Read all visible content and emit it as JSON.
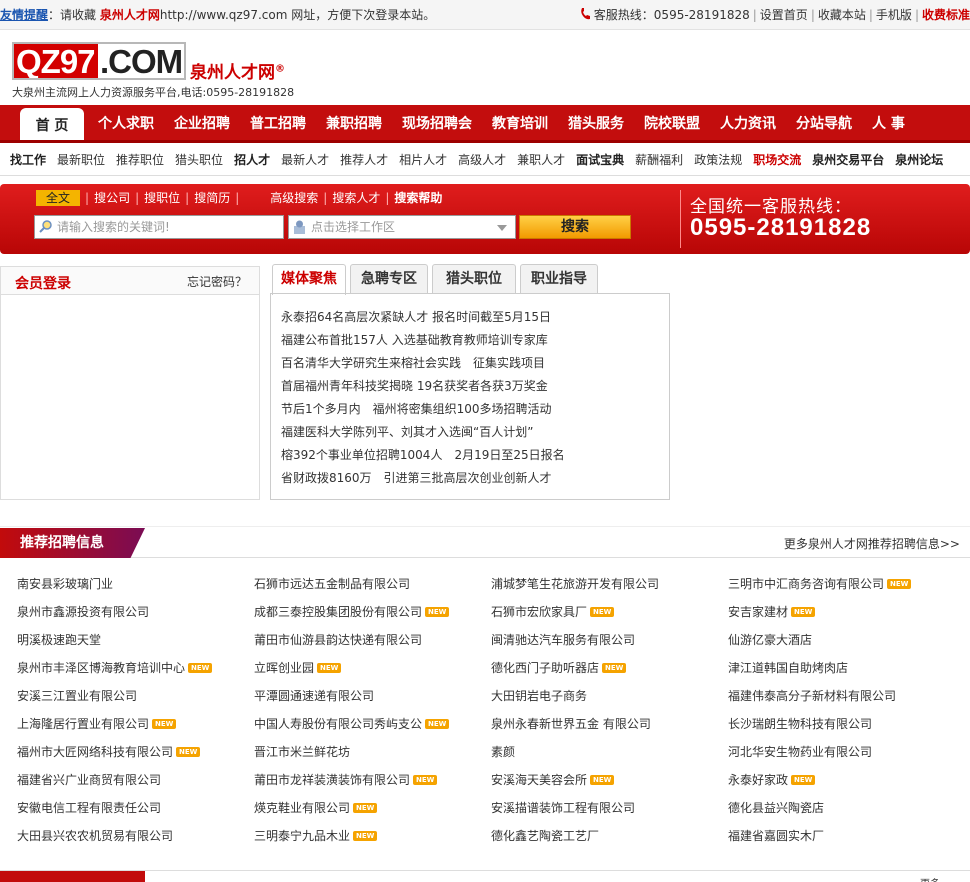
{
  "topbar": {
    "tip_label": "友情提醒",
    "tip_text": "：请收藏 ",
    "site_name": "泉州人才网",
    "tip_url": "http://www.qz97.com 网址，方便下次登录本站。",
    "hotline": "客服热线：0595-28191828",
    "links": [
      "设置首页",
      "收藏本站",
      "手机版"
    ],
    "fee_link": "收费标准"
  },
  "header": {
    "logo_qz": "QZ97",
    "logo_com": ".COM",
    "logo_cn": "泉州人才网",
    "logo_reg": "®",
    "slogan": "大泉州主流网上人力资源服务平台,电话:0595-28191828"
  },
  "nav": {
    "home": "首 页",
    "items": [
      "个人求职",
      "企业招聘",
      "普工招聘",
      "兼职招聘",
      "现场招聘会",
      "教育培训",
      "猎头服务",
      "院校联盟",
      "人力资讯",
      "分站导航",
      "人 事"
    ]
  },
  "subnav": [
    {
      "label": "找工作",
      "style": "b"
    },
    {
      "label": "最新职位",
      "style": ""
    },
    {
      "label": "推荐职位",
      "style": ""
    },
    {
      "label": "猎头职位",
      "style": ""
    },
    {
      "label": "招人才",
      "style": "b"
    },
    {
      "label": "最新人才",
      "style": ""
    },
    {
      "label": "推荐人才",
      "style": ""
    },
    {
      "label": "相片人才",
      "style": ""
    },
    {
      "label": "高级人才",
      "style": ""
    },
    {
      "label": "兼职人才",
      "style": ""
    },
    {
      "label": "面试宝典",
      "style": "b"
    },
    {
      "label": "薪酬福利",
      "style": ""
    },
    {
      "label": "政策法规",
      "style": ""
    },
    {
      "label": "职场交流",
      "style": "rb"
    },
    {
      "label": "泉州交易平台",
      "style": "b"
    },
    {
      "label": "泉州论坛",
      "style": "b"
    }
  ],
  "search": {
    "tab_all": "全文",
    "tabs": [
      "搜公司",
      "搜职位",
      "搜简历"
    ],
    "adv": [
      "高级搜索",
      "搜索人才"
    ],
    "help": "搜索帮助",
    "keyword_placeholder": "请输入搜索的关键词!",
    "area_placeholder": "点击选择工作区",
    "button": "搜索",
    "hotline_title": "全国统一客服热线：",
    "hotline_number": "0595-28191828"
  },
  "login": {
    "title": "会员登录",
    "forgot": "忘记密码？"
  },
  "news": {
    "tabs": [
      "媒体聚焦",
      "急聘专区",
      "猎头职位",
      "职业指导"
    ],
    "items": [
      "永泰招64名高层次紧缺人才 报名时间截至5月15日",
      "福建公布首批157人 入选基础教育教师培训专家库",
      "百名清华大学研究生来榕社会实践　征集实践项目",
      "首届福州青年科技奖揭晓 19名获奖者各获3万奖金",
      "节后1个多月内　福州将密集组织100多场招聘活动",
      "福建医科大学陈列平、刘其才入选闽“百人计划”",
      "榕392个事业单位招聘1004人　2月19日至25日报名",
      "省财政拨8160万　引进第三批高层次创业创新人才"
    ]
  },
  "recommend": {
    "title": "推荐招聘信息",
    "more": "更多泉州人才网推荐招聘信息>>",
    "new_badge": "NEW",
    "companies": [
      {
        "name": "南安县彩玻璃门业",
        "new": false
      },
      {
        "name": "石狮市远达五金制品有限公司",
        "new": false
      },
      {
        "name": "浦城梦笔生花旅游开发有限公司",
        "new": false
      },
      {
        "name": "三明市中汇商务咨询有限公司",
        "new": true
      },
      {
        "name": "泉州市鑫源投资有限公司",
        "new": false
      },
      {
        "name": "成都三泰控股集团股份有限公司",
        "new": true
      },
      {
        "name": "石狮市宏欣家具厂",
        "new": true
      },
      {
        "name": "安吉家建材",
        "new": true
      },
      {
        "name": "明溪极速跑天堂",
        "new": false
      },
      {
        "name": "莆田市仙游县韵达快递有限公司",
        "new": false
      },
      {
        "name": "闽清驰达汽车服务有限公司",
        "new": false
      },
      {
        "name": "仙游亿豪大酒店",
        "new": false
      },
      {
        "name": "泉州市丰泽区博海教育培训中心",
        "new": true
      },
      {
        "name": "立晖创业园",
        "new": true
      },
      {
        "name": "德化西门子助听器店",
        "new": true
      },
      {
        "name": "津江道韩国自助烤肉店",
        "new": false
      },
      {
        "name": "安溪三江置业有限公司",
        "new": false
      },
      {
        "name": "平潭圆通速递有限公司",
        "new": false
      },
      {
        "name": "大田钥岩电子商务",
        "new": false
      },
      {
        "name": "福建伟泰高分子新材料有限公司",
        "new": false
      },
      {
        "name": "上海隆居行置业有限公司",
        "new": true
      },
      {
        "name": "中国人寿股份有限公司秀屿支公",
        "new": true
      },
      {
        "name": "泉州永春新世界五金 有限公司",
        "new": false
      },
      {
        "name": "长沙瑞朗生物科技有限公司",
        "new": false
      },
      {
        "name": "福州市大匠网络科技有限公司",
        "new": true
      },
      {
        "name": "晋江市米兰鲜花坊",
        "new": false
      },
      {
        "name": "素颜",
        "new": false
      },
      {
        "name": "河北华安生物药业有限公司",
        "new": false
      },
      {
        "name": "福建省兴广业商贸有限公司",
        "new": false
      },
      {
        "name": "莆田市龙祥装潢装饰有限公司",
        "new": true
      },
      {
        "name": "安溪海天美容会所",
        "new": true
      },
      {
        "name": "永泰好家政",
        "new": true
      },
      {
        "name": "安徽电信工程有限责任公司",
        "new": false
      },
      {
        "name": "煐克鞋业有限公司",
        "new": true
      },
      {
        "name": "安溪描谱装饰工程有限公司",
        "new": false
      },
      {
        "name": "德化县益兴陶瓷店",
        "new": false
      },
      {
        "name": "大田县兴农农机贸易有限公司",
        "new": false
      },
      {
        "name": "三明泰宁九品木业",
        "new": true
      },
      {
        "name": "德化鑫艺陶瓷工艺厂",
        "new": false
      },
      {
        "name": "福建省嘉圆实木厂",
        "new": false
      }
    ]
  },
  "bottom": {
    "more": "更多"
  }
}
